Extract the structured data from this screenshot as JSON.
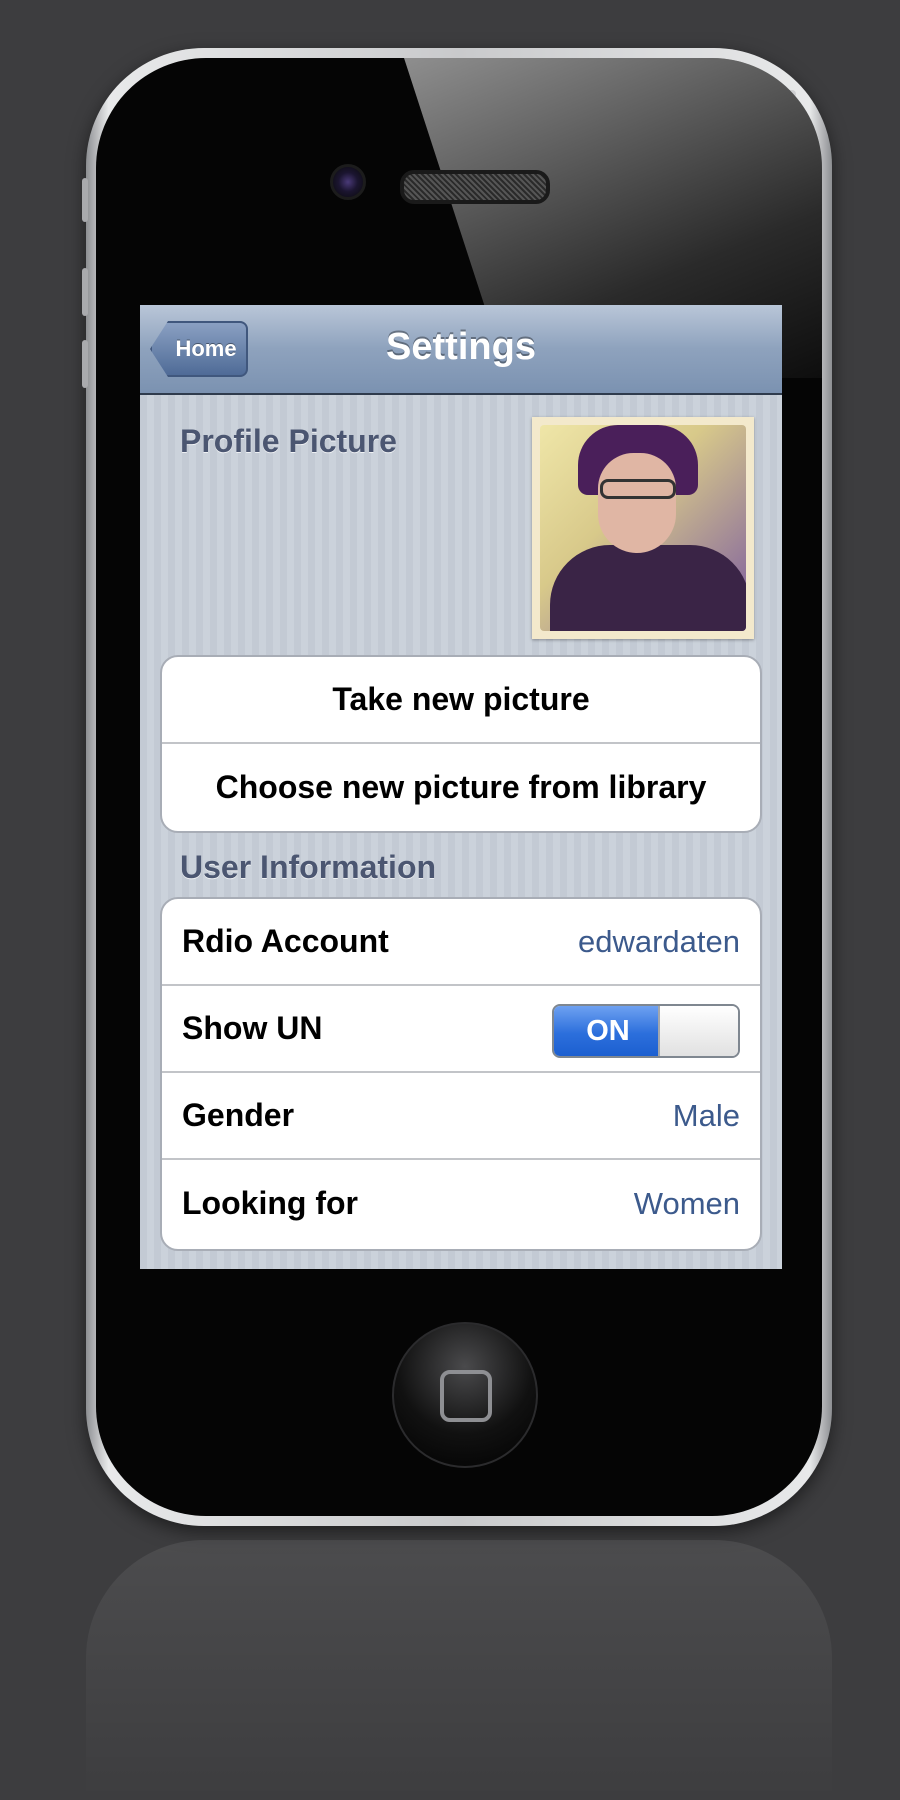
{
  "navbar": {
    "back_label": "Home",
    "title": "Settings"
  },
  "profile": {
    "section_label": "Profile Picture",
    "actions": [
      "Take new picture",
      "Choose new picture from library"
    ]
  },
  "user_info": {
    "section_label": "User Information",
    "rows": [
      {
        "label": "Rdio Account",
        "value": "edwardaten"
      },
      {
        "label": "Show UN",
        "toggle_label": "ON",
        "toggle_state": "on"
      },
      {
        "label": "Gender",
        "value": "Male"
      },
      {
        "label": "Looking for",
        "value": "Women"
      }
    ]
  },
  "colors": {
    "accent_value": "#3c5a8c",
    "toggle_on": "#2c6fdc",
    "navbar": "#8ea2bd"
  },
  "icons": [
    "home-button-icon",
    "camera-icon",
    "speaker-icon"
  ]
}
